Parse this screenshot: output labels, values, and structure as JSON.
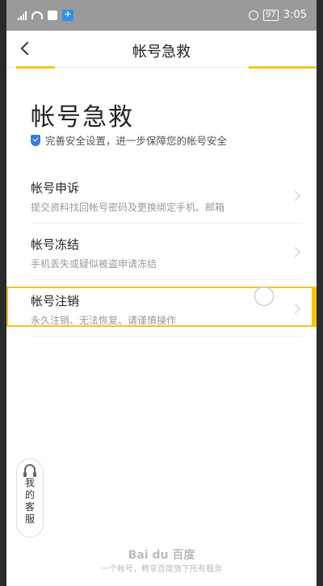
{
  "status_bar": {
    "time": "3:05",
    "battery": "97"
  },
  "nav": {
    "title": "帐号急救"
  },
  "page": {
    "title": "帐号急救",
    "subtitle": "完善安全设置，进一步保障您的帐号安全"
  },
  "items": [
    {
      "name": "帐号申诉",
      "desc": "提交资料找回帐号密码及更换绑定手机、邮箱"
    },
    {
      "name": "帐号冻结",
      "desc": "手机丢失或疑似被盗申请冻结"
    },
    {
      "name": "帐号注销",
      "desc": "永久注销、无法恢复、请谨慎操作"
    }
  ],
  "customer_service": {
    "label": "我的客服"
  },
  "footer": {
    "logo": "Bai du 百度",
    "text": "一个帐号，畅享百度旗下所有服务"
  },
  "colors": {
    "accent": "#f5c518",
    "shield": "#3a7bd5",
    "status_bar": "#9a9a9a"
  },
  "icons": [
    "signal-icon",
    "wifi-icon",
    "notification-icon",
    "plane-icon",
    "clock-icon",
    "battery-icon",
    "back-icon",
    "shield-icon",
    "chevron-right-icon",
    "headset-icon"
  ]
}
